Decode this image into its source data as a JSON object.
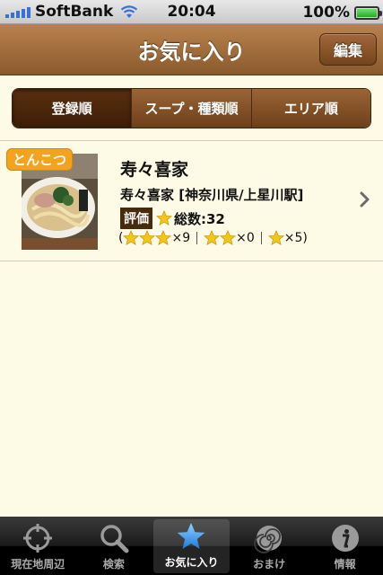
{
  "status_bar": {
    "carrier": "SoftBank",
    "time": "20:04",
    "battery": "100%"
  },
  "nav": {
    "title": "お気に入り",
    "edit_label": "編集"
  },
  "segments": [
    {
      "label": "登録順",
      "selected": true
    },
    {
      "label": "スープ・種類順",
      "selected": false
    },
    {
      "label": "エリア順",
      "selected": false
    }
  ],
  "favorites": [
    {
      "tag": "とんこつ",
      "name": "寿々喜家",
      "location": "寿々喜家 [神奈川県/上星川駅]",
      "rating_label": "評価",
      "total": "総数:32",
      "count_open": "(",
      "count_3": "×9",
      "count_2": "×0",
      "count_1": "×5)"
    }
  ],
  "tabs": [
    {
      "label": "現在地周辺",
      "icon": "crosshair-icon"
    },
    {
      "label": "検索",
      "icon": "magnifier-icon"
    },
    {
      "label": "お気に入り",
      "icon": "star-icon",
      "active": true
    },
    {
      "label": "おまけ",
      "icon": "naruto-icon"
    },
    {
      "label": "情報",
      "icon": "info-icon"
    }
  ],
  "colors": {
    "nav_brown": "#8a5a2d",
    "background": "#fdfbe6",
    "tag_orange": "#f5a31e",
    "star_gold": "#f5c518"
  }
}
